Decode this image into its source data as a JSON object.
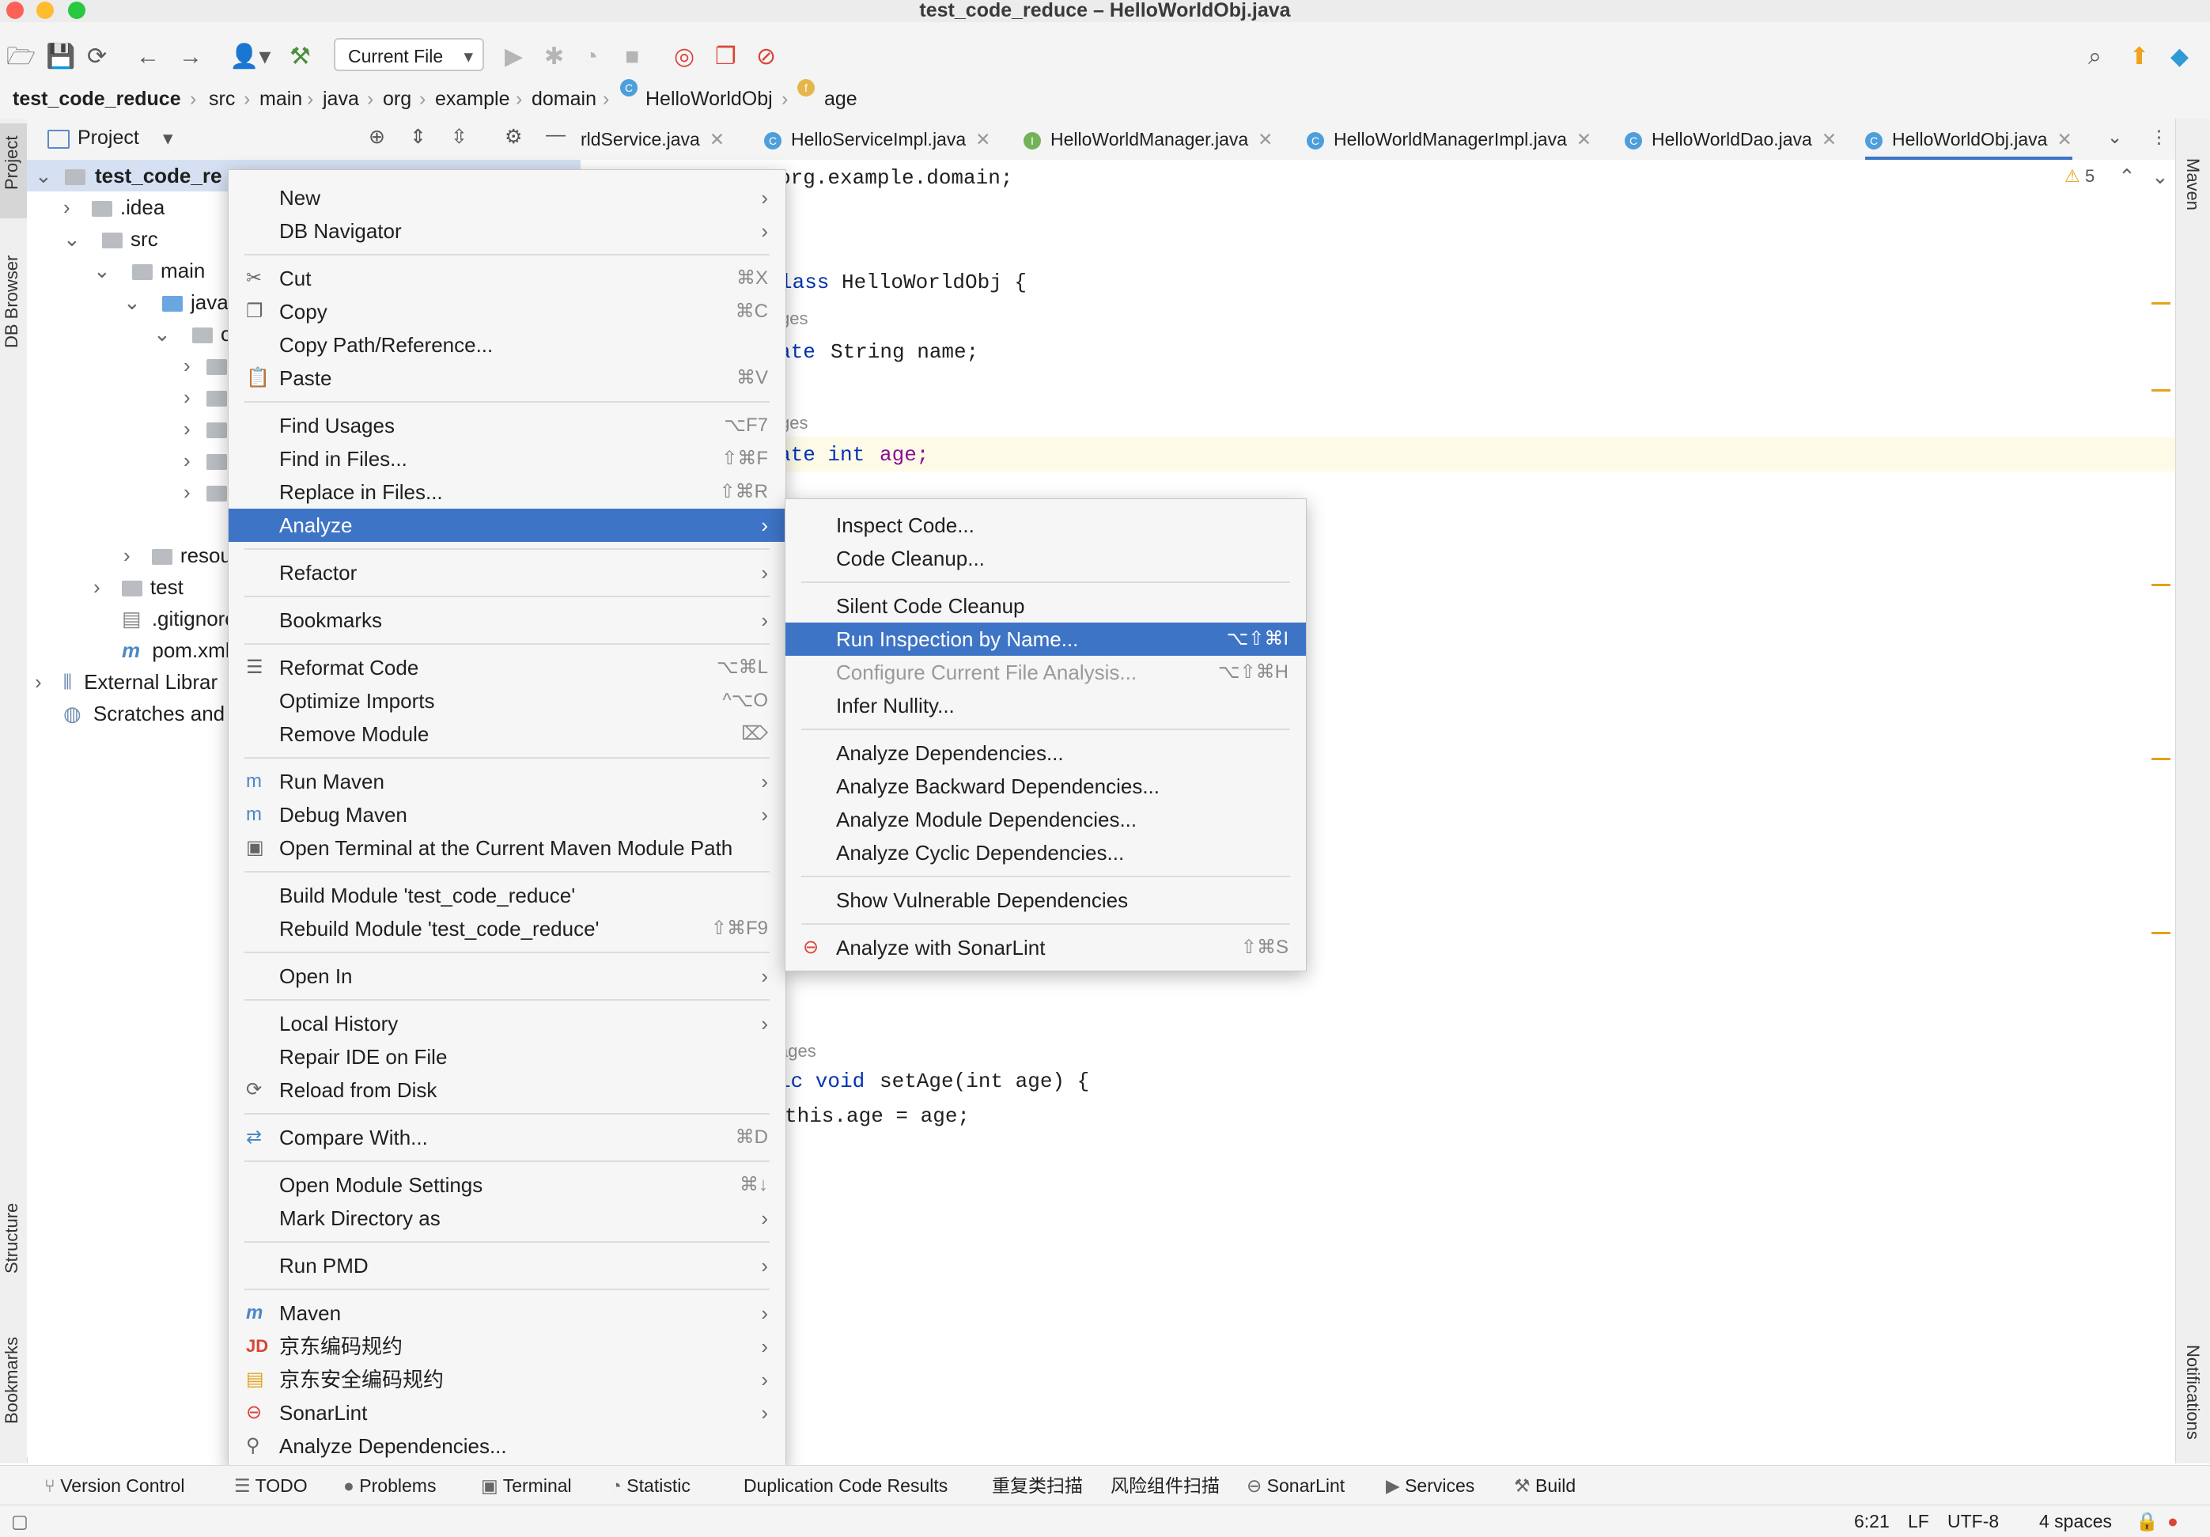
{
  "window": {
    "title": "test_code_reduce – HelloWorldObj.java"
  },
  "toolbar": {
    "run_config": "Current File"
  },
  "breadcrumb": [
    "test_code_reduce",
    "src",
    "main",
    "java",
    "org",
    "example",
    "domain",
    "HelloWorldObj",
    "age"
  ],
  "left_strip": {
    "project": "Project",
    "db_browser": "DB Browser",
    "structure": "Structure",
    "bookmarks": "Bookmarks"
  },
  "right_strip": {
    "maven": "Maven",
    "notifications": "Notifications"
  },
  "project_panel": {
    "title": "Project"
  },
  "tabs": [
    "rldService.java",
    "HelloServiceImpl.java",
    "HelloWorldManager.java",
    "HelloWorldManagerImpl.java",
    "HelloWorldDao.java",
    "HelloWorldObj.java"
  ],
  "tree": {
    "root": "test_code_re",
    "idea": ".idea",
    "src": "src",
    "main": "main",
    "java": "java",
    "org": "or",
    "resources": "resou",
    "test": "test",
    "gitignore": ".gitignore",
    "pom": "pom.xml",
    "external": "External Librar",
    "scratches": "Scratches and"
  },
  "editor": {
    "warnings": "5",
    "lines": {
      "package": "org.example.domain;",
      "class_decl_kw": "lass",
      "class_decl_name": "HelloWorldObj {",
      "usages1": "ges",
      "field1_kw": "ate",
      "field1_rest": "String name;",
      "usages2": "ges",
      "field2_kw": "ate int",
      "field2_rest": "age;",
      "usages3": "ages",
      "setter_kw": "ic void",
      "setter_rest": "setAge(int age) {",
      "setter_body": "this.age = age;"
    }
  },
  "context_menu": {
    "items": [
      {
        "label": "New",
        "shortcut": "",
        "submenu": true
      },
      {
        "label": "DB Navigator",
        "shortcut": "",
        "submenu": true
      },
      {
        "label": "Cut",
        "shortcut": "⌘X"
      },
      {
        "label": "Copy",
        "shortcut": "⌘C"
      },
      {
        "label": "Copy Path/Reference...",
        "shortcut": ""
      },
      {
        "label": "Paste",
        "shortcut": "⌘V"
      },
      {
        "label": "Find Usages",
        "shortcut": "⌥F7"
      },
      {
        "label": "Find in Files...",
        "shortcut": "⇧⌘F"
      },
      {
        "label": "Replace in Files...",
        "shortcut": "⇧⌘R"
      },
      {
        "label": "Analyze",
        "shortcut": "",
        "submenu": true
      },
      {
        "label": "Refactor",
        "shortcut": "",
        "submenu": true
      },
      {
        "label": "Bookmarks",
        "shortcut": "",
        "submenu": true
      },
      {
        "label": "Reformat Code",
        "shortcut": "⌥⌘L"
      },
      {
        "label": "Optimize Imports",
        "shortcut": "^⌥O"
      },
      {
        "label": "Remove Module",
        "shortcut": "⌦"
      },
      {
        "label": "Run Maven",
        "shortcut": "",
        "submenu": true
      },
      {
        "label": "Debug Maven",
        "shortcut": "",
        "submenu": true
      },
      {
        "label": "Open Terminal at the Current Maven Module Path",
        "shortcut": ""
      },
      {
        "label": "Build Module 'test_code_reduce'",
        "shortcut": ""
      },
      {
        "label": "Rebuild Module 'test_code_reduce'",
        "shortcut": "⇧⌘F9"
      },
      {
        "label": "Open In",
        "shortcut": "",
        "submenu": true
      },
      {
        "label": "Local History",
        "shortcut": "",
        "submenu": true
      },
      {
        "label": "Repair IDE on File",
        "shortcut": ""
      },
      {
        "label": "Reload from Disk",
        "shortcut": ""
      },
      {
        "label": "Compare With...",
        "shortcut": "⌘D"
      },
      {
        "label": "Open Module Settings",
        "shortcut": "⌘↓"
      },
      {
        "label": "Mark Directory as",
        "shortcut": "",
        "submenu": true
      },
      {
        "label": "Run PMD",
        "shortcut": "",
        "submenu": true
      },
      {
        "label": "Maven",
        "shortcut": "",
        "submenu": true
      },
      {
        "label": "京东编码规约",
        "shortcut": "",
        "submenu": true
      },
      {
        "label": "京东安全编码规约",
        "shortcut": "",
        "submenu": true
      },
      {
        "label": "SonarLint",
        "shortcut": "",
        "submenu": true
      },
      {
        "label": "Analyze Dependencies...",
        "shortcut": ""
      }
    ]
  },
  "analyze_menu": {
    "items": [
      {
        "label": "Inspect Code...",
        "shortcut": ""
      },
      {
        "label": "Code Cleanup...",
        "shortcut": ""
      },
      {
        "label": "Silent Code Cleanup",
        "shortcut": ""
      },
      {
        "label": "Run Inspection by Name...",
        "shortcut": "⌥⇧⌘I"
      },
      {
        "label": "Configure Current File Analysis...",
        "shortcut": "⌥⇧⌘H"
      },
      {
        "label": "Infer Nullity...",
        "shortcut": ""
      },
      {
        "label": "Analyze Dependencies...",
        "shortcut": ""
      },
      {
        "label": "Analyze Backward Dependencies...",
        "shortcut": ""
      },
      {
        "label": "Analyze Module Dependencies...",
        "shortcut": ""
      },
      {
        "label": "Analyze Cyclic Dependencies...",
        "shortcut": ""
      },
      {
        "label": "Show Vulnerable Dependencies",
        "shortcut": ""
      },
      {
        "label": "Analyze with SonarLint",
        "shortcut": "⇧⌘S"
      }
    ]
  },
  "bottom_tabs": [
    "Version Control",
    "TODO",
    "Problems",
    "Terminal",
    "Statistic",
    "Duplication Code Results",
    "重复类扫描",
    "风险组件扫描",
    "SonarLint",
    "Services",
    "Build"
  ],
  "status": {
    "position": "6:21",
    "line_sep": "LF",
    "encoding": "UTF-8",
    "indent": "4 spaces"
  },
  "colors": {
    "selection": "#3e74c6",
    "keyword": "#0033b3",
    "field": "#871094",
    "warning": "#e3a21a"
  }
}
